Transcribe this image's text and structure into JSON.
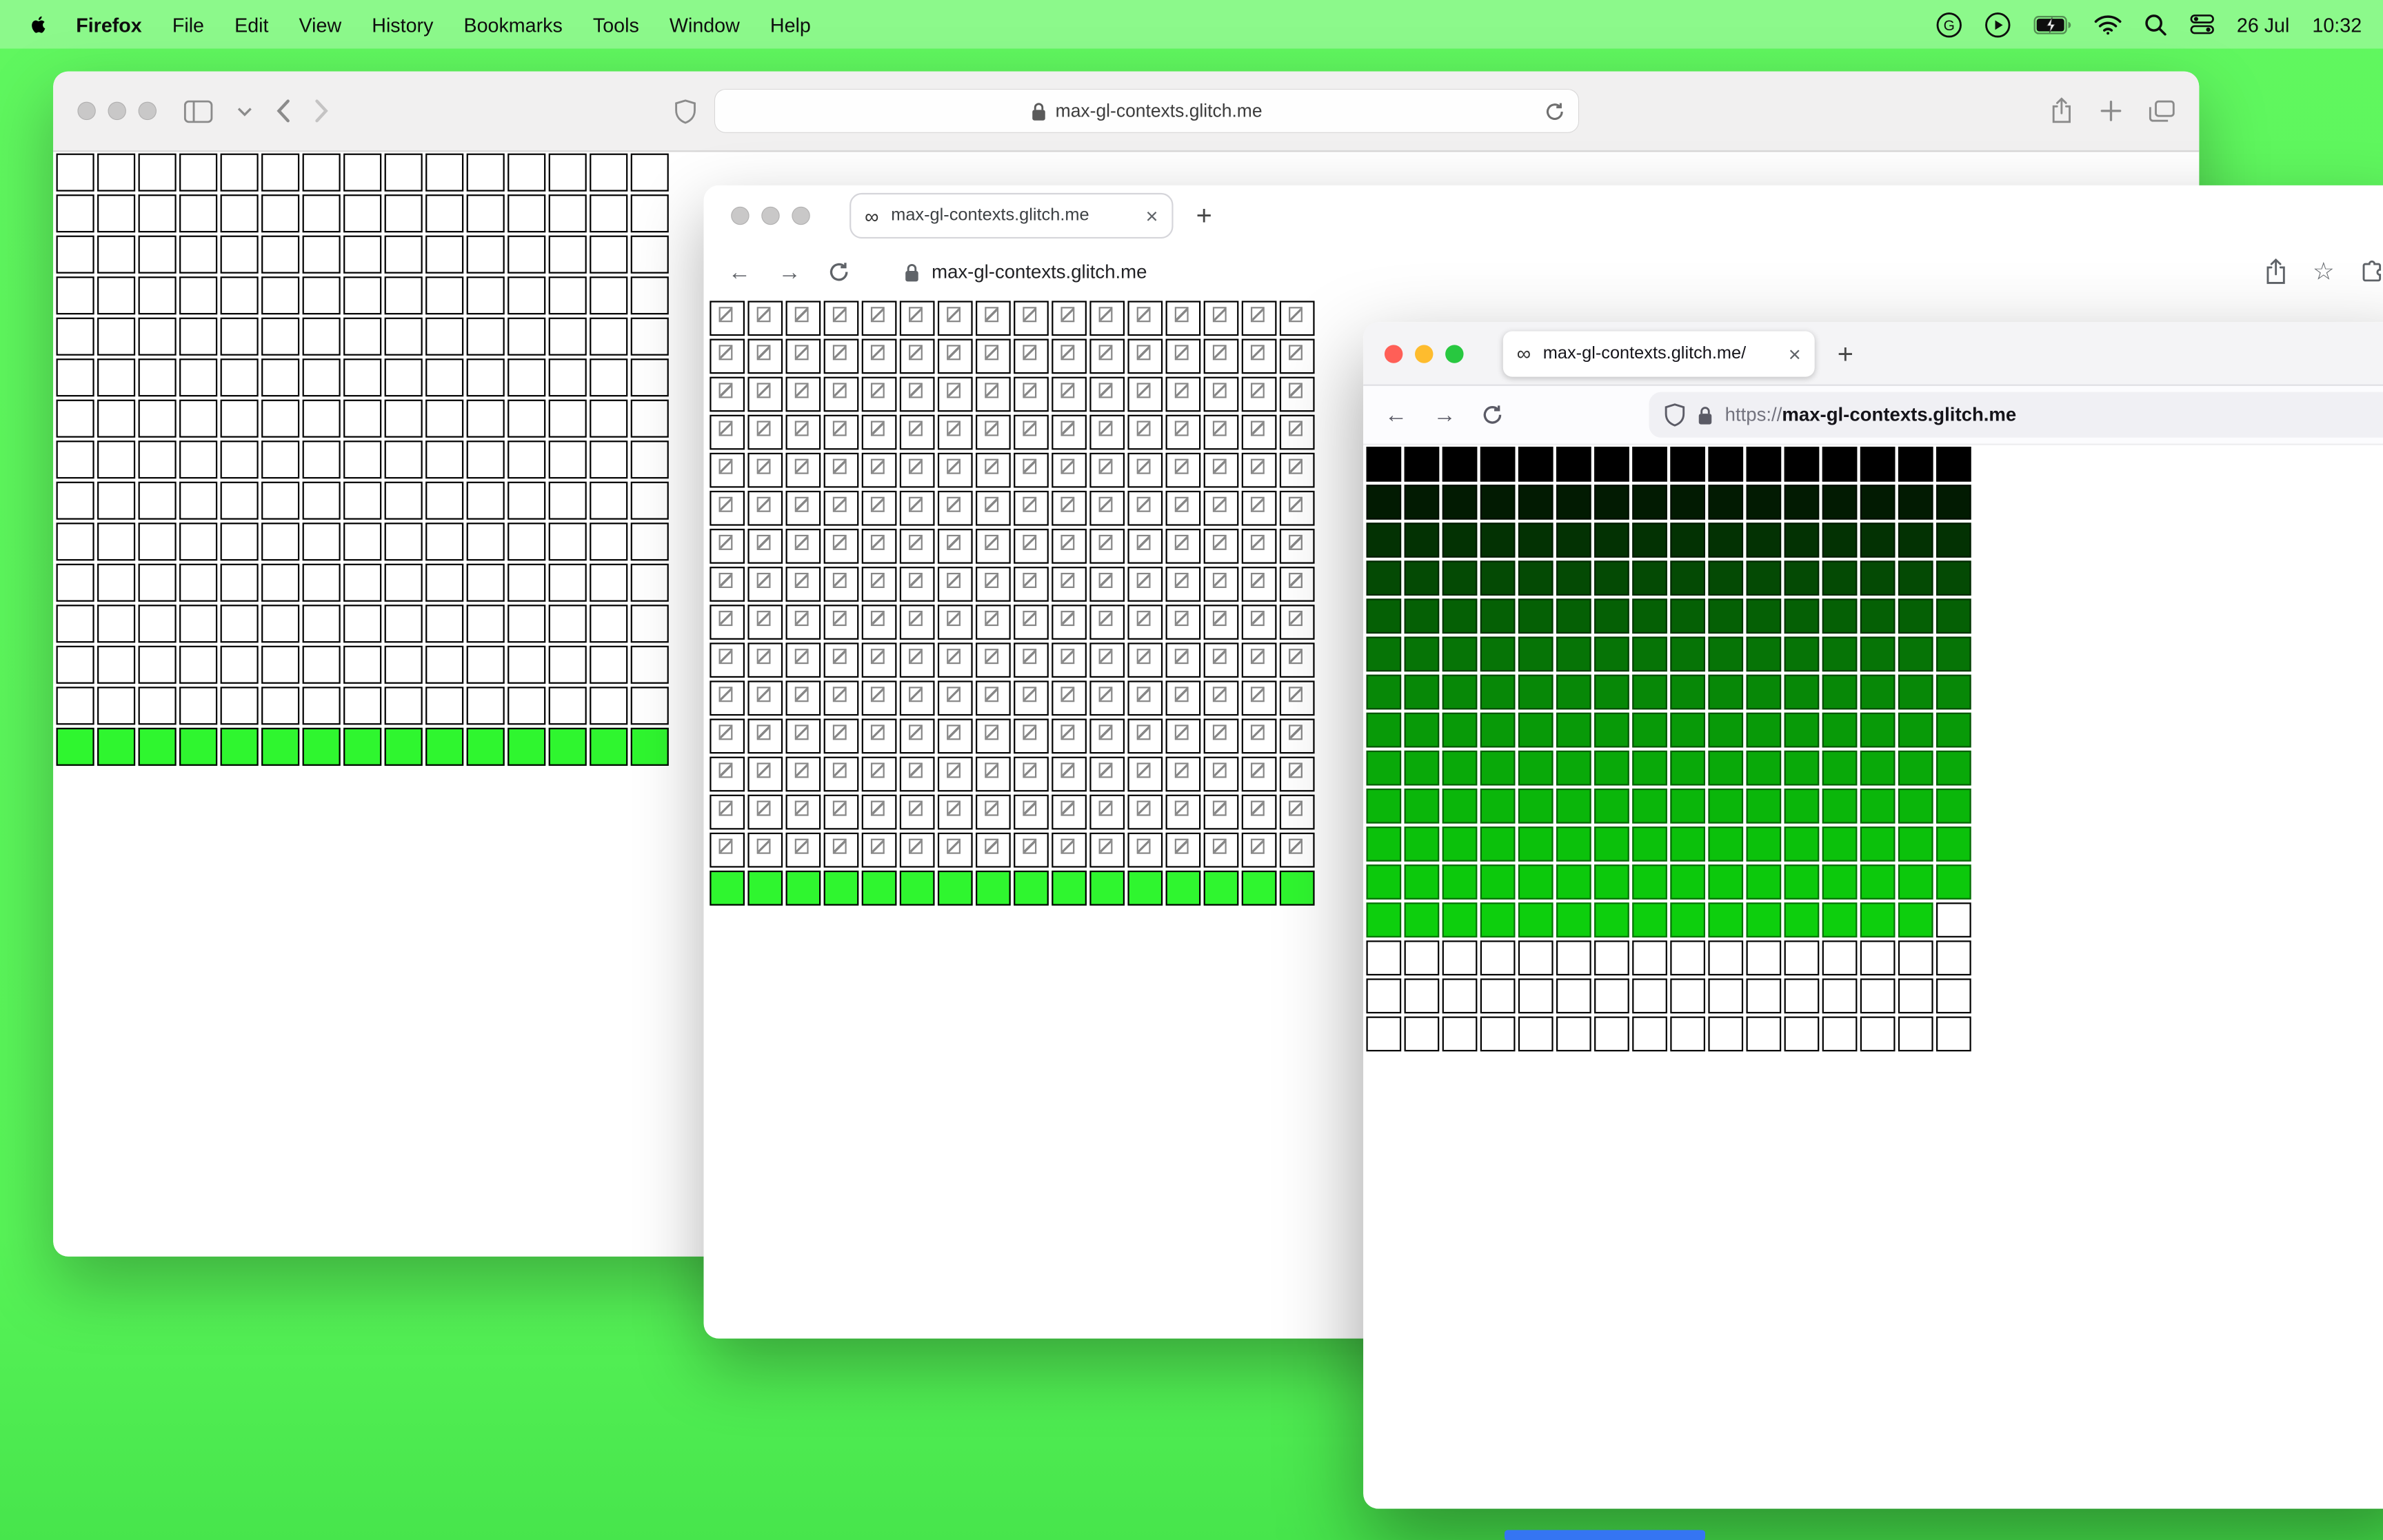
{
  "desktop": {
    "background": "#58f458",
    "dock_peek_color": "#3575f2"
  },
  "menu_bar": {
    "app_name": "Firefox",
    "menus": [
      "File",
      "Edit",
      "View",
      "History",
      "Bookmarks",
      "Tools",
      "Window",
      "Help"
    ],
    "date": "26 Jul",
    "time": "10:32"
  },
  "glyphs": {
    "infinity": "∞",
    "close": "×",
    "plus": "+",
    "star": "☆",
    "back_arrow": "←",
    "forward_arrow": "→"
  },
  "safari_window": {
    "url": "max-gl-contexts.glitch.me",
    "grid": {
      "cols": 15,
      "rows": 15,
      "green_row_index": 14,
      "white": "#ffffff",
      "green": "#2ff62f"
    }
  },
  "chrome_window": {
    "tab_title": "max-gl-contexts.glitch.me",
    "url": "max-gl-contexts.glitch.me",
    "grid": {
      "cols": 16,
      "rows": 16,
      "green_row_index": 15,
      "white": "#ffffff",
      "green": "#2ff62f"
    }
  },
  "firefox_window": {
    "tab_title": "max-gl-contexts.glitch.me/",
    "url_scheme": "https://",
    "url_host": "max-gl-contexts.glitch.me",
    "grid": {
      "cols": 16,
      "rows": 16,
      "row_colors": [
        "#000000",
        "#021b02",
        "#033203",
        "#044a04",
        "#056005",
        "#067406",
        "#078807",
        "#089a08",
        "#09a909",
        "#0ab60a",
        "#0bc10b",
        "#0cc90c",
        "#0dcf0d"
      ],
      "partial_row_index": 12,
      "partial_green_cells": 15,
      "white_rows_from": 13,
      "white": "#ffffff"
    }
  }
}
